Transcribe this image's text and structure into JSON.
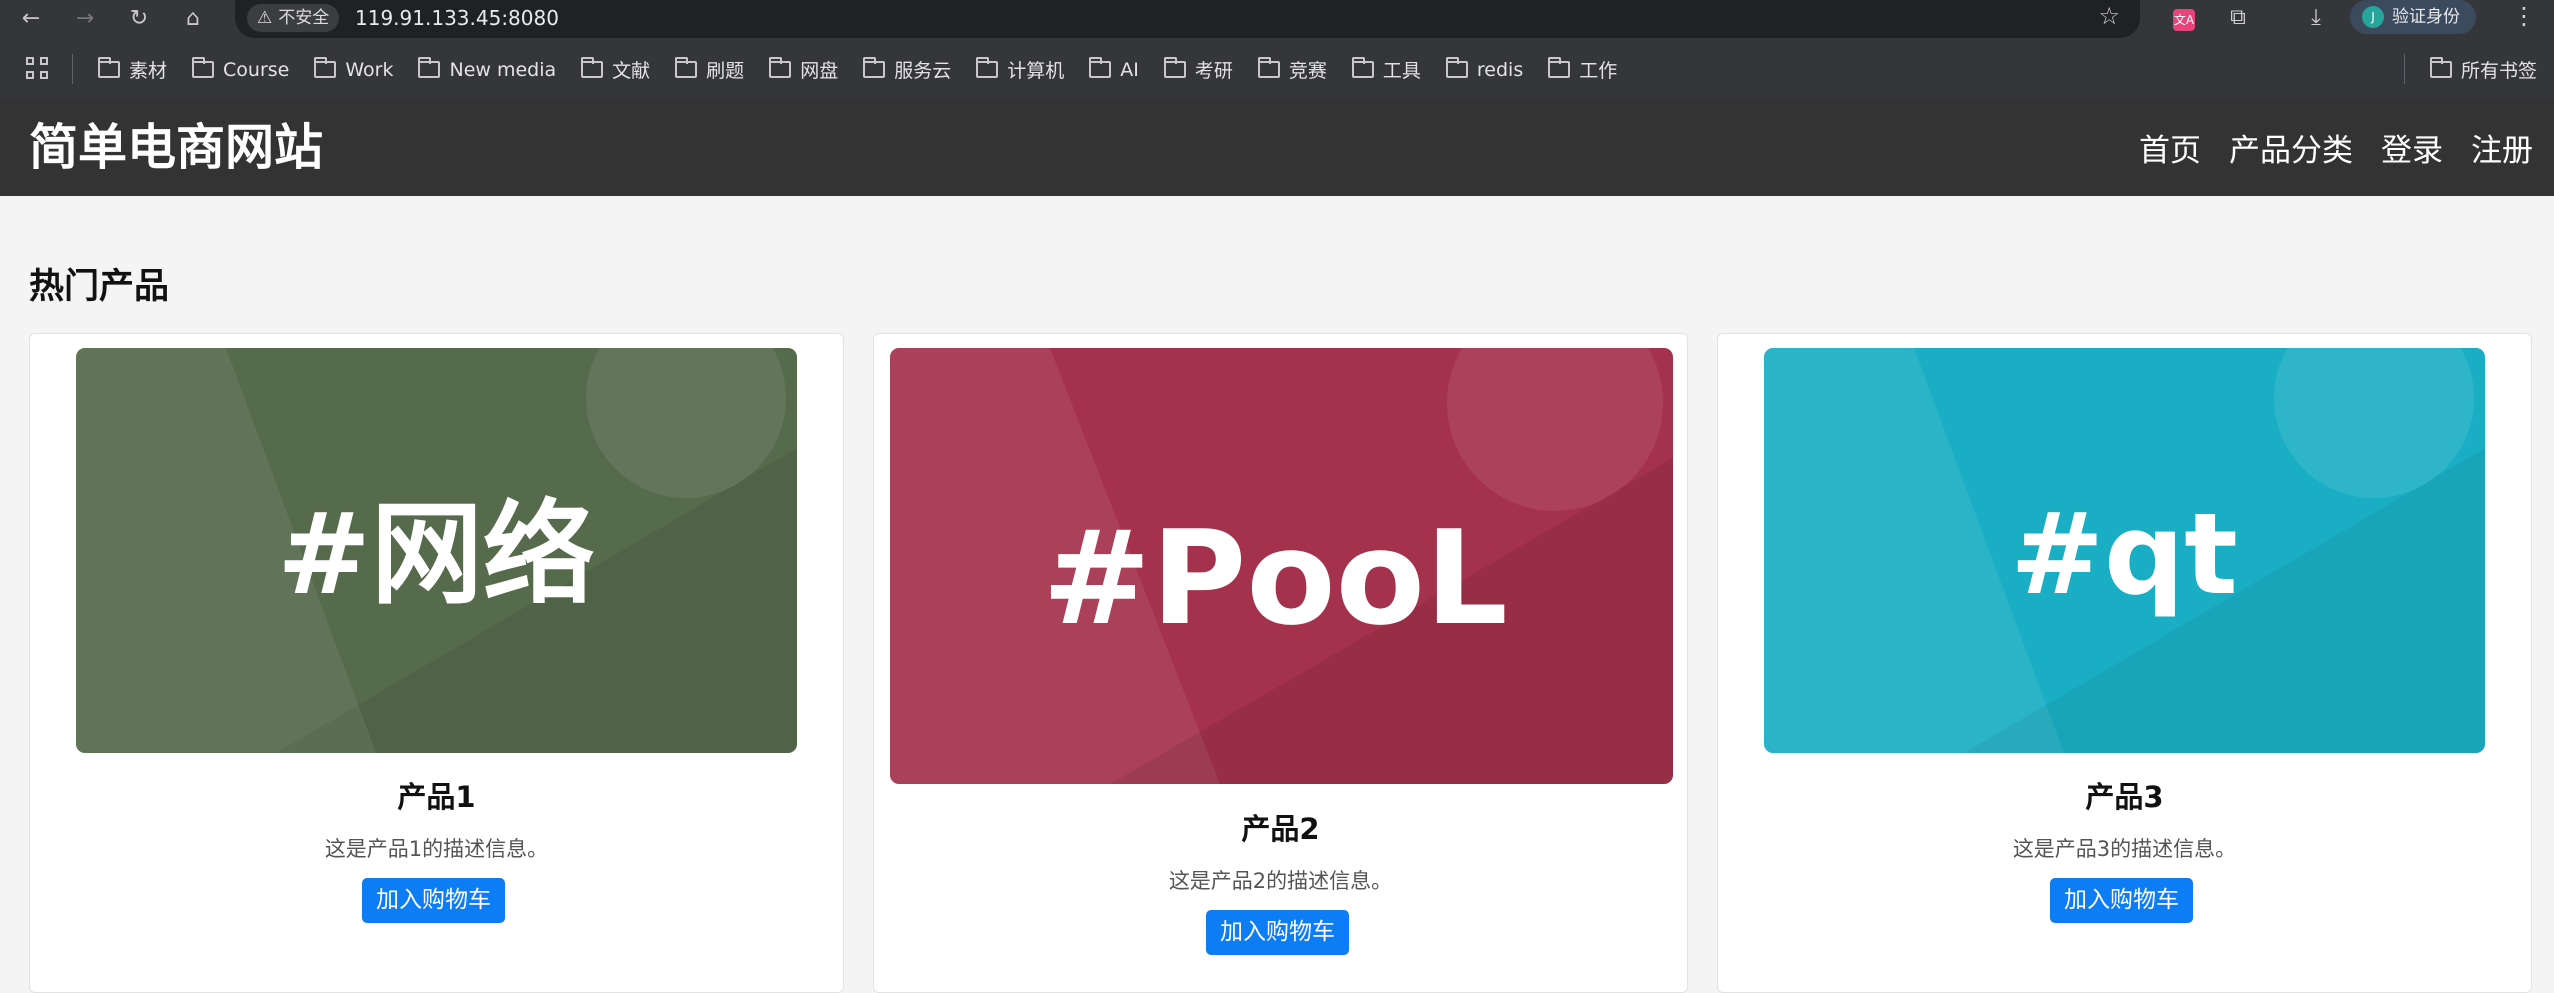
{
  "browser": {
    "security_label": "不安全",
    "url": "119.91.133.45:8080",
    "verify_label": "验证身份",
    "avatar_letter": "J",
    "translate_icon_text": "文A",
    "bookmarks": [
      "素材",
      "Course",
      "Work",
      "New media",
      "文献",
      "刷题",
      "网盘",
      "服务云",
      "计算机",
      "AI",
      "考研",
      "竞赛",
      "工具",
      "redis",
      "工作"
    ],
    "all_bookmarks": "所有书签"
  },
  "site": {
    "title": "简单电商网站",
    "nav": [
      "首页",
      "产品分类",
      "登录",
      "注册"
    ]
  },
  "section": {
    "title": "热门产品"
  },
  "products": [
    {
      "image_text": "#网络",
      "image_color": "#566a4c",
      "name": "产品1",
      "description": "这是产品1的描述信息。",
      "button": "加入购物车"
    },
    {
      "image_text": "#PooL",
      "image_color": "#a5324d",
      "name": "产品2",
      "description": "这是产品2的描述信息。",
      "button": "加入购物车"
    },
    {
      "image_text": "#qt",
      "image_color": "#1aaec4",
      "name": "产品3",
      "description": "这是产品3的描述信息。",
      "button": "加入购物车"
    }
  ]
}
